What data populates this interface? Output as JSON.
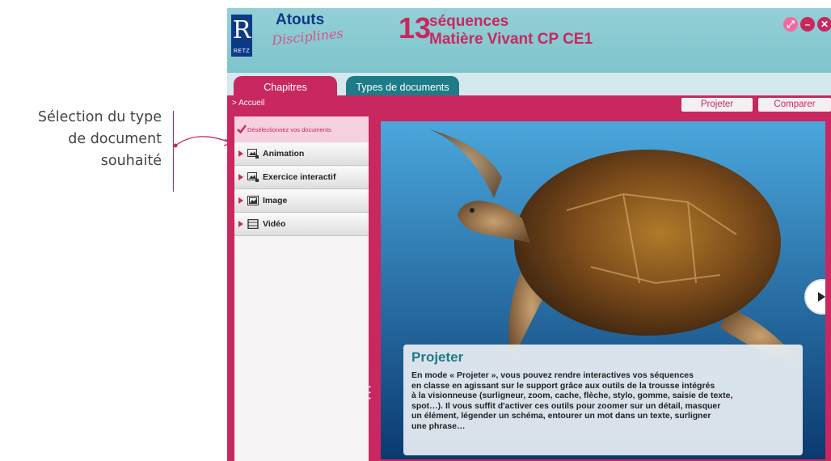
{
  "annotation": {
    "lines": [
      "Sélection du type",
      "de document",
      "souhaité"
    ]
  },
  "header": {
    "logo_letter": "R",
    "logo_text": "RETZ",
    "brand_top": "Atouts",
    "brand_bottom": "Disciplines",
    "sequence_number": "13",
    "sequence_label": "séquences",
    "sequence_title": "Matière Vivant CP CE1"
  },
  "window_controls": {
    "fullscreen_icon": "⤢",
    "minimize_icon": "–",
    "close_icon": "✕"
  },
  "tabs": [
    {
      "label": "Chapitres"
    },
    {
      "label": "Types de documents"
    }
  ],
  "breadcrumb": "> Accueil",
  "actions": {
    "project": "Projeter",
    "compare": "Comparer"
  },
  "sidebar": {
    "deselect": "Désélectionnez vos documents",
    "items": [
      {
        "label": "Animation",
        "icon": "animation-icon"
      },
      {
        "label": "Exercice interactif",
        "icon": "interactive-exercise-icon"
      },
      {
        "label": "Image",
        "icon": "image-icon"
      },
      {
        "label": "Vidéo",
        "icon": "video-icon"
      }
    ]
  },
  "slide": {
    "title": "Projeter",
    "body_lines": [
      "En mode « Projeter », vous pouvez rendre interactives vos séquences",
      "en classe en agissant sur le support grâce aux outils de la trousse intégrés",
      "à la visionneuse (surligneur, zoom, cache, flèche, stylo, gomme, saisie de texte,",
      "spot…). Il vous suffit d'activer ces outils pour zoomer sur un détail, masquer",
      "un élément, légender un schéma, entourer un mot dans un texte, surligner",
      "une phrase…"
    ]
  },
  "colors": {
    "accent": "#c8285f",
    "teal": "#1e7b88",
    "header": "#8ccbd1",
    "navy": "#0d3a86"
  }
}
